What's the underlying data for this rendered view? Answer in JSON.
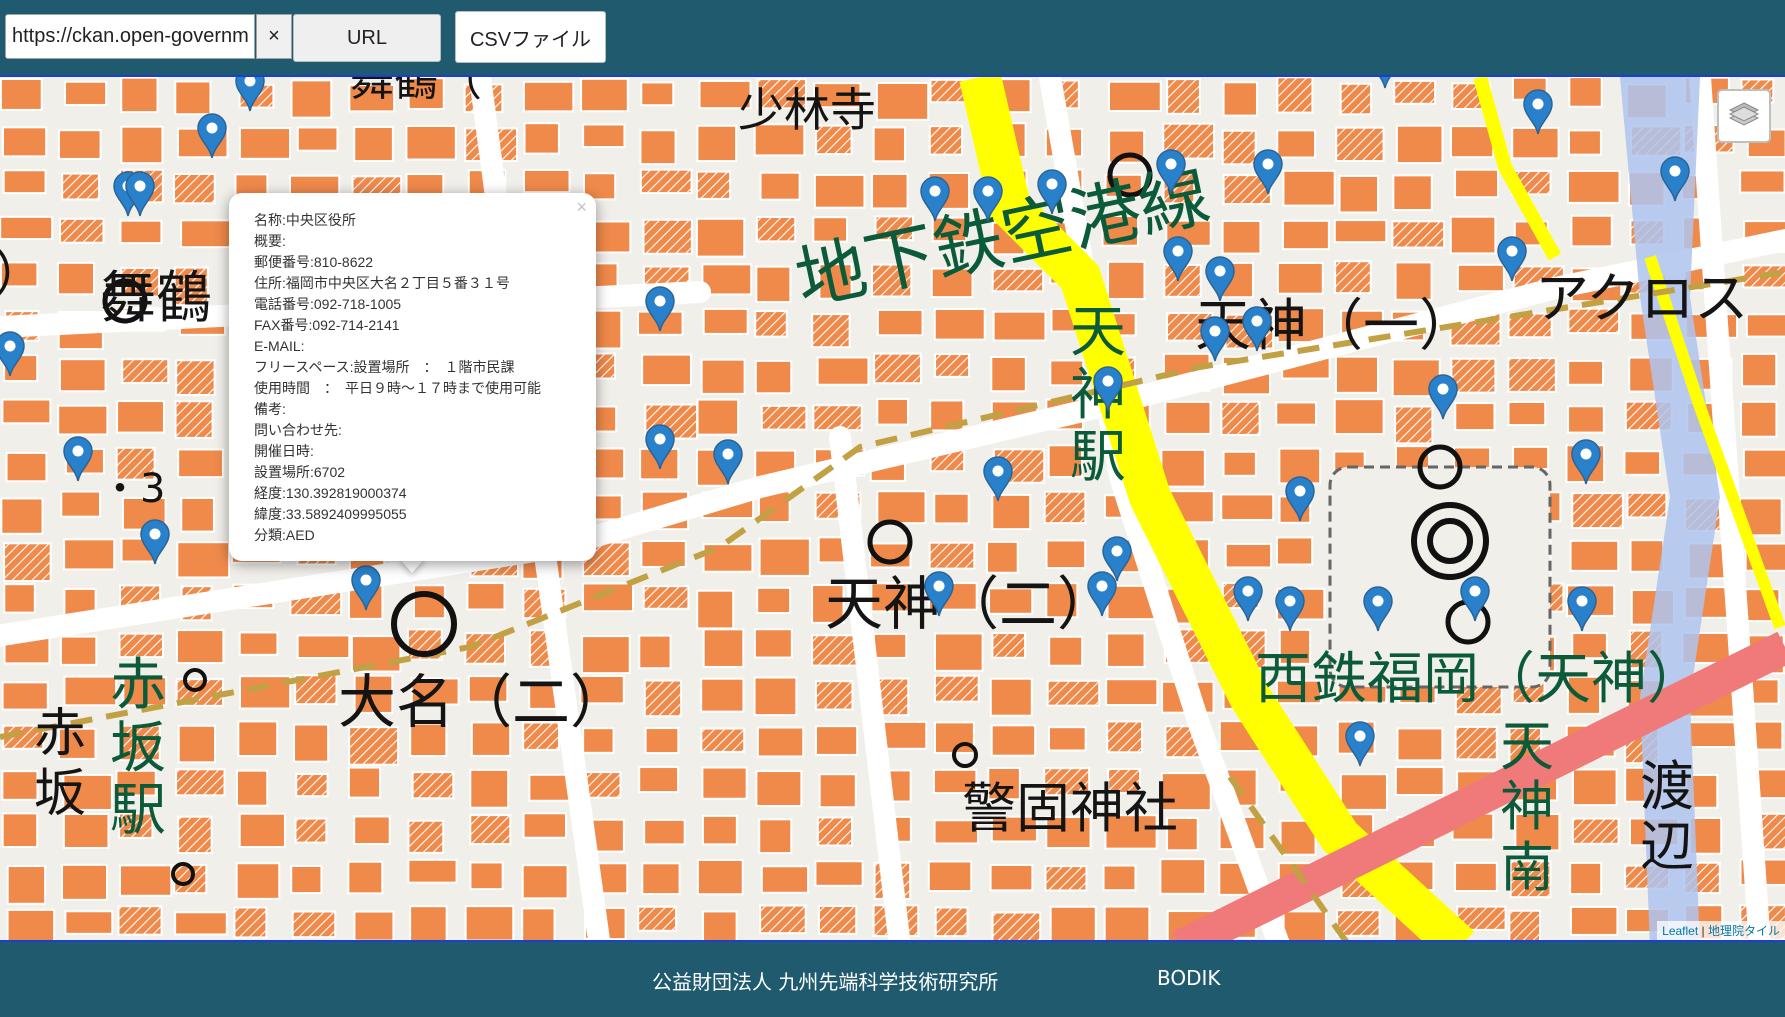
{
  "toolbar": {
    "url_value": "https://ckan.open-governme",
    "clear_label": "×",
    "url_button_label": "URL",
    "csv_button_label": "CSVファイル"
  },
  "map": {
    "base_layer": "地理院タイル",
    "labels": {
      "shorinji": "少林寺",
      "maizuru_a": "舞鶴（",
      "maizuru_b": "舞鶴",
      "subway_line": "地下鉄空港線",
      "tenjin_1": "天神（一）",
      "acros": "アクロス",
      "tenjin_station": "天神駅",
      "tenjin_2": "天神（二）",
      "daimyo_2": "大名（二）",
      "akasaka_station": "赤坂駅",
      "akasaka": "赤坂",
      "nishitetsu": "西鉄福岡（天神）",
      "keigo_shrine": "警固神社",
      "tenjin_minami": "天神南",
      "watanabe": "渡辺",
      "block_3": "・3",
      "paren_close": "）"
    },
    "marker_count": 40,
    "marker_color": "#2a81cb",
    "attribution": {
      "leaflet": "Leaflet",
      "separator": " | ",
      "tiles": "地理院タイル"
    }
  },
  "popup": {
    "close_label": "×",
    "rows": [
      "名称:中央区役所",
      "概要:",
      "郵便番号:810-8622",
      "住所:福岡市中央区大名２丁目５番３１号",
      "電話番号:092-718-1005",
      "FAX番号:092-714-2141",
      "E-MAIL:",
      "フリースペース:設置場所　：　１階市民課",
      "使用時間　：　平日９時～１７時まで使用可能",
      "備考:",
      "問い合わせ先:",
      "開催日時:",
      "設置場所:6702",
      "経度:130.392819000374",
      "緯度:33.5892409995055",
      "分類:AED"
    ]
  },
  "footer": {
    "org": "公益財団法人 九州先端科学技術研究所",
    "brand": "BODIK"
  },
  "colors": {
    "header_bg": "#1f5a6e",
    "building": "#f08a4b",
    "subway_yellow": "#ffff00",
    "railway_red": "#f07a7a",
    "river": "#aec4ee",
    "text_green": "#0b5b3a"
  }
}
